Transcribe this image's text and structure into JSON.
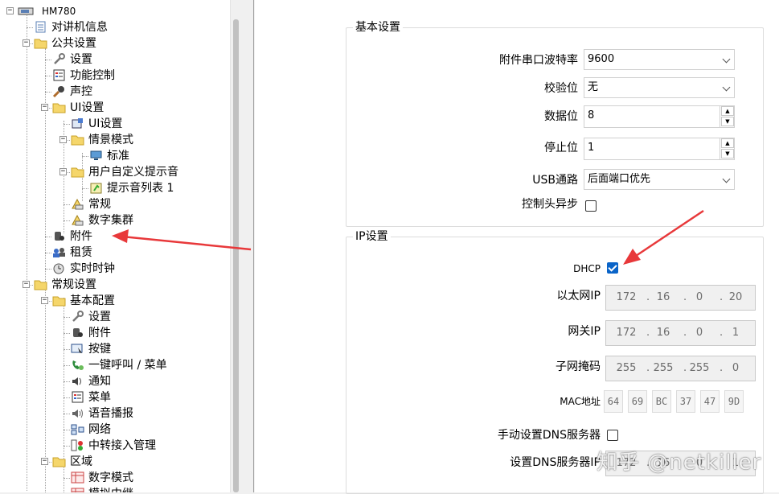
{
  "tree": {
    "root": "HM780",
    "items": [
      {
        "label": "对讲机信息"
      },
      {
        "label": "公共设置"
      },
      {
        "label": "设置"
      },
      {
        "label": "功能控制"
      },
      {
        "label": "声控"
      },
      {
        "label": "UI设置"
      },
      {
        "label": "UI设置"
      },
      {
        "label": "情景模式"
      },
      {
        "label": "标准"
      },
      {
        "label": "用户自定义提示音"
      },
      {
        "label": "提示音列表 1"
      },
      {
        "label": "常规"
      },
      {
        "label": "数字集群"
      },
      {
        "label": "附件"
      },
      {
        "label": "租赁"
      },
      {
        "label": "实时时钟"
      },
      {
        "label": "常规设置"
      },
      {
        "label": "基本配置"
      },
      {
        "label": "设置"
      },
      {
        "label": "附件"
      },
      {
        "label": "按键"
      },
      {
        "label": "一键呼叫 / 菜单"
      },
      {
        "label": "通知"
      },
      {
        "label": "菜单"
      },
      {
        "label": "语音播报"
      },
      {
        "label": "网络"
      },
      {
        "label": "中转接入管理"
      },
      {
        "label": "区域"
      },
      {
        "label": "数字模式"
      },
      {
        "label": "模拟中继"
      }
    ]
  },
  "basic": {
    "title": "基本设置",
    "baud_label": "附件串口波特率",
    "baud_value": "9600",
    "parity_label": "校验位",
    "parity_value": "无",
    "databits_label": "数据位",
    "databits_value": "8",
    "stopbits_label": "停止位",
    "stopbits_value": "1",
    "usb_label": "USB通路",
    "usb_value": "后面端口优先",
    "async_label": "控制头异步",
    "async_checked": false
  },
  "ip": {
    "title": "IP设置",
    "dhcp_label": "DHCP",
    "dhcp_checked": true,
    "eth_label": "以太网IP",
    "eth": [
      "172",
      "16",
      "0",
      "20"
    ],
    "gw_label": "网关IP",
    "gw": [
      "172",
      "16",
      "0",
      "1"
    ],
    "mask_label": "子网掩码",
    "mask": [
      "255",
      "255",
      "255",
      "0"
    ],
    "mac_label": "MAC地址",
    "mac": [
      "64",
      "69",
      "BC",
      "37",
      "47",
      "9D"
    ],
    "dns_manual_label": "手动设置DNS服务器",
    "dns_manual_checked": false,
    "dns_server_label": "设置DNS服务器IP",
    "dns": [
      "172",
      "16",
      "0",
      "1"
    ]
  },
  "watermark": "知乎 @netkiller",
  "colors": {
    "arrow": "#e8383a",
    "check": "#0a64c8"
  }
}
